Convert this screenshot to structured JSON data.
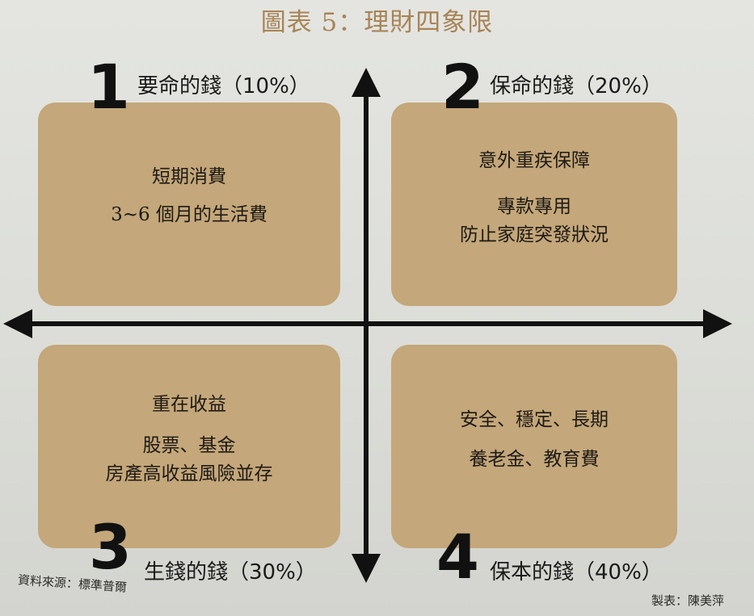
{
  "title": "圖表 5：理財四象限",
  "quadrants": [
    {
      "number": "1",
      "label": "要命的錢（10%）",
      "lines": [
        "短期消費",
        "3~6 個月的生活費"
      ]
    },
    {
      "number": "2",
      "label": "保命的錢（20%）",
      "lines": [
        "意外重疾保障",
        "專款專用",
        "防止家庭突發狀況"
      ]
    },
    {
      "number": "3",
      "label": "生錢的錢（30%）",
      "lines": [
        "重在收益",
        "股票、基金",
        "房產高收益風險並存"
      ]
    },
    {
      "number": "4",
      "label": "保本的錢（40%）",
      "lines": [
        "安全、穩定、長期",
        "養老金、教育費"
      ]
    }
  ],
  "source": "資料來源：標準普爾",
  "author": "製表：陳美萍",
  "colors": {
    "box": "#c4a77a",
    "title": "#a88456",
    "axis": "#111111"
  }
}
